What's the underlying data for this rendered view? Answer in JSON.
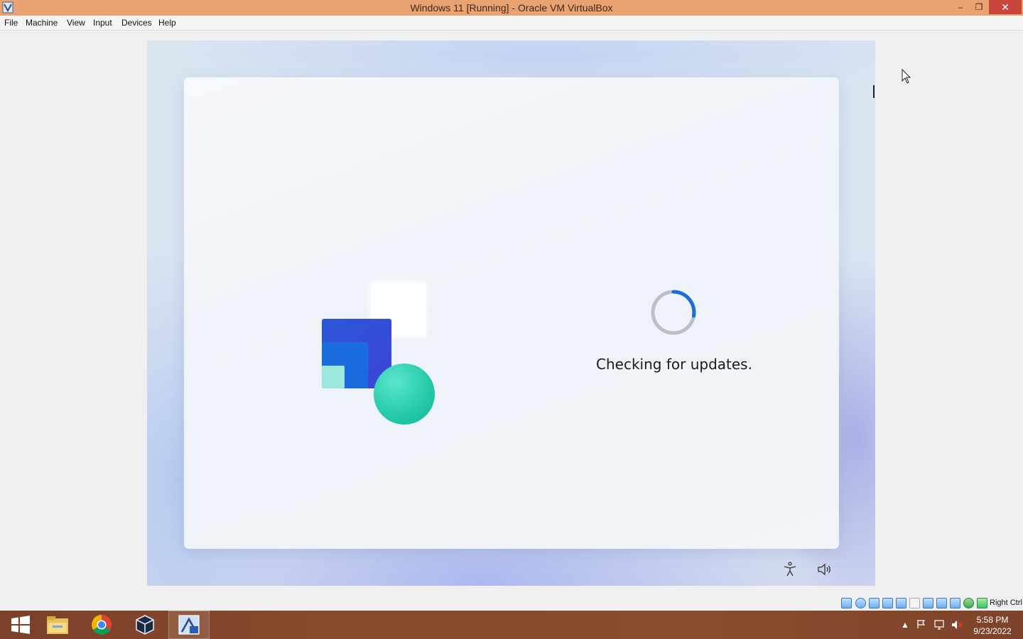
{
  "window": {
    "title": "Windows 11 [Running] - Oracle VM VirtualBox",
    "controls": {
      "minimize": "‒",
      "maximize": "❐",
      "close": "✕"
    }
  },
  "menu": [
    "File",
    "Machine",
    "View",
    "Input",
    "Devices",
    "Help"
  ],
  "vm": {
    "status_text": "Checking for updates.",
    "icons": [
      "accessibility-icon",
      "volume-icon"
    ],
    "colors": {
      "blue": "#2b57d8",
      "teal": "#23c9a8",
      "mint": "#9ee9df",
      "spinner": "#1a6fd0"
    }
  },
  "statusbar": {
    "icons": [
      "hard-disk-icon",
      "optical-drive-icon",
      "audio-icon",
      "network-icon",
      "usb-icon",
      "shared-folders-icon",
      "display-icon",
      "video-capture-icon",
      "cpu-icon",
      "mouse-integration-icon",
      "keyboard-icon"
    ],
    "host_key": "Right Ctrl"
  },
  "taskbar": {
    "apps": [
      "start-button",
      "file-explorer",
      "chrome",
      "virtualbox-manager",
      "windows-11-vm"
    ],
    "clock": {
      "time": "5:58 PM",
      "date": "9/23/2022"
    }
  }
}
